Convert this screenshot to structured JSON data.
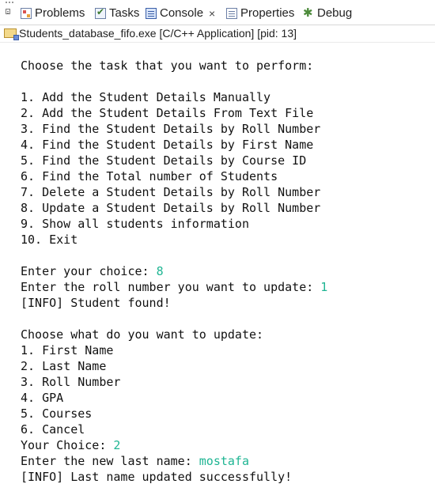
{
  "tabs": [
    {
      "label": "Problems",
      "icon": "problems-icon"
    },
    {
      "label": "Tasks",
      "icon": "tasks-icon"
    },
    {
      "label": "Console",
      "icon": "console-icon",
      "active": true,
      "close": "×"
    },
    {
      "label": "Properties",
      "icon": "properties-icon"
    },
    {
      "label": "Debug",
      "icon": "debug-icon"
    }
  ],
  "process_line": "Students_database_fifo.exe [C/C++ Application]  [pid: 13]",
  "console": {
    "input_color": "#1fb593",
    "lines": [
      {
        "text": "Choose the task that you want to perform:"
      },
      {
        "text": ""
      },
      {
        "text": "1. Add the Student Details Manually"
      },
      {
        "text": "2. Add the Student Details From Text File"
      },
      {
        "text": "3. Find the Student Details by Roll Number"
      },
      {
        "text": "4. Find the Student Details by First Name"
      },
      {
        "text": "5. Find the Student Details by Course ID"
      },
      {
        "text": "6. Find the Total number of Students"
      },
      {
        "text": "7. Delete a Student Details by Roll Number"
      },
      {
        "text": "8. Update a Student Details by Roll Number"
      },
      {
        "text": "9. Show all students information"
      },
      {
        "text": "10. Exit"
      },
      {
        "text": ""
      },
      {
        "text": "Enter your choice: ",
        "input": "8"
      },
      {
        "text": "Enter the roll number you want to update: ",
        "input": "1"
      },
      {
        "text": "[INFO] Student found!"
      },
      {
        "text": ""
      },
      {
        "text": "Choose what do you want to update:"
      },
      {
        "text": "1. First Name"
      },
      {
        "text": "2. Last Name"
      },
      {
        "text": "3. Roll Number"
      },
      {
        "text": "4. GPA"
      },
      {
        "text": "5. Courses"
      },
      {
        "text": "6. Cancel"
      },
      {
        "text": "Your Choice: ",
        "input": "2"
      },
      {
        "text": "Enter the new last name: ",
        "input": "mostafa"
      },
      {
        "text": "[INFO] Last name updated successfully!"
      }
    ]
  }
}
